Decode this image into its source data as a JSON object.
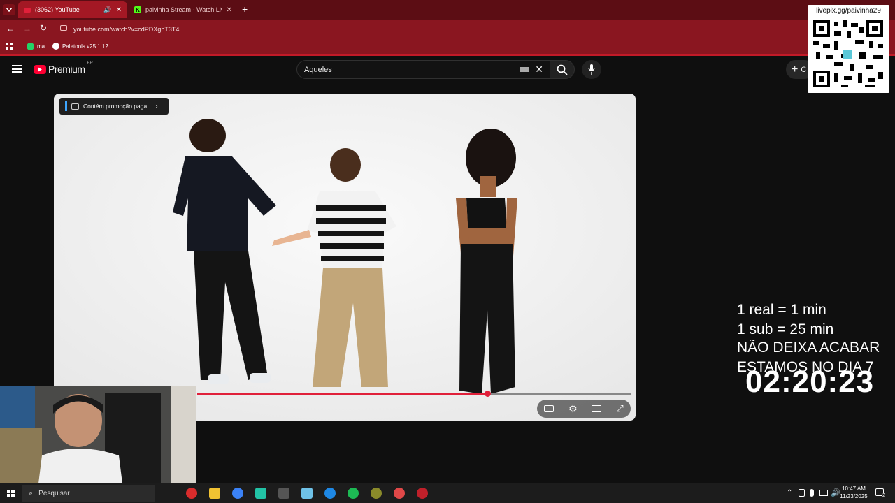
{
  "browser": {
    "tabs": [
      {
        "label": "(3062) YouTube",
        "active": true
      },
      {
        "label": "paivinha Stream - Watch Live o",
        "active": false
      }
    ],
    "url": "youtube.com/watch?v=cdPDXgbT3T4",
    "bookmarks": [
      {
        "label": "ma",
        "icon": "whatsapp-icon"
      },
      {
        "label": "Paletools v25.1.12",
        "icon": "paletools-icon"
      }
    ]
  },
  "youtube": {
    "logo_text": "Premium",
    "logo_badge": "BR",
    "search_value": "Aqueles",
    "create_label": "C",
    "promo_label": "Contém promoção paga",
    "progress_fraction": 0.67
  },
  "overlay": {
    "qr_url": "livepix.gg/paivinha29",
    "lines": [
      "1 real = 1 min",
      "1 sub = 25 min",
      "NÃO DEIXA ACABAR",
      "ESTAMOS NO DIA 7"
    ],
    "timer": "02:20:23"
  },
  "taskbar": {
    "search_label": "Pesquisar",
    "time": "10:47 AM",
    "date": "11/23/2025",
    "notification_count": "2"
  },
  "colors": {
    "accent": "#e0203a",
    "chrome": "#8a1620",
    "tabbar": "#5c0d14"
  }
}
